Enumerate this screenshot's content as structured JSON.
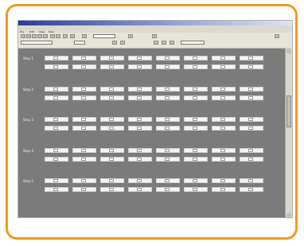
{
  "window": {
    "title": "",
    "menus": [
      "File",
      "Edit",
      "View",
      "Help"
    ],
    "toolbar_fields": [
      "",
      "",
      "",
      ""
    ]
  },
  "steps": [
    {
      "label": "Step 1"
    },
    {
      "label": "Step 2"
    },
    {
      "label": "Step 3"
    },
    {
      "label": "Step 4"
    },
    {
      "label": "Step 5"
    }
  ],
  "columns": 8,
  "rows_per_step": 2,
  "colors": {
    "frame": "#f39a1e",
    "canvas": "#7b7b7b",
    "cell": "#f4f4f4",
    "titlebar": "#2e3c9a"
  }
}
